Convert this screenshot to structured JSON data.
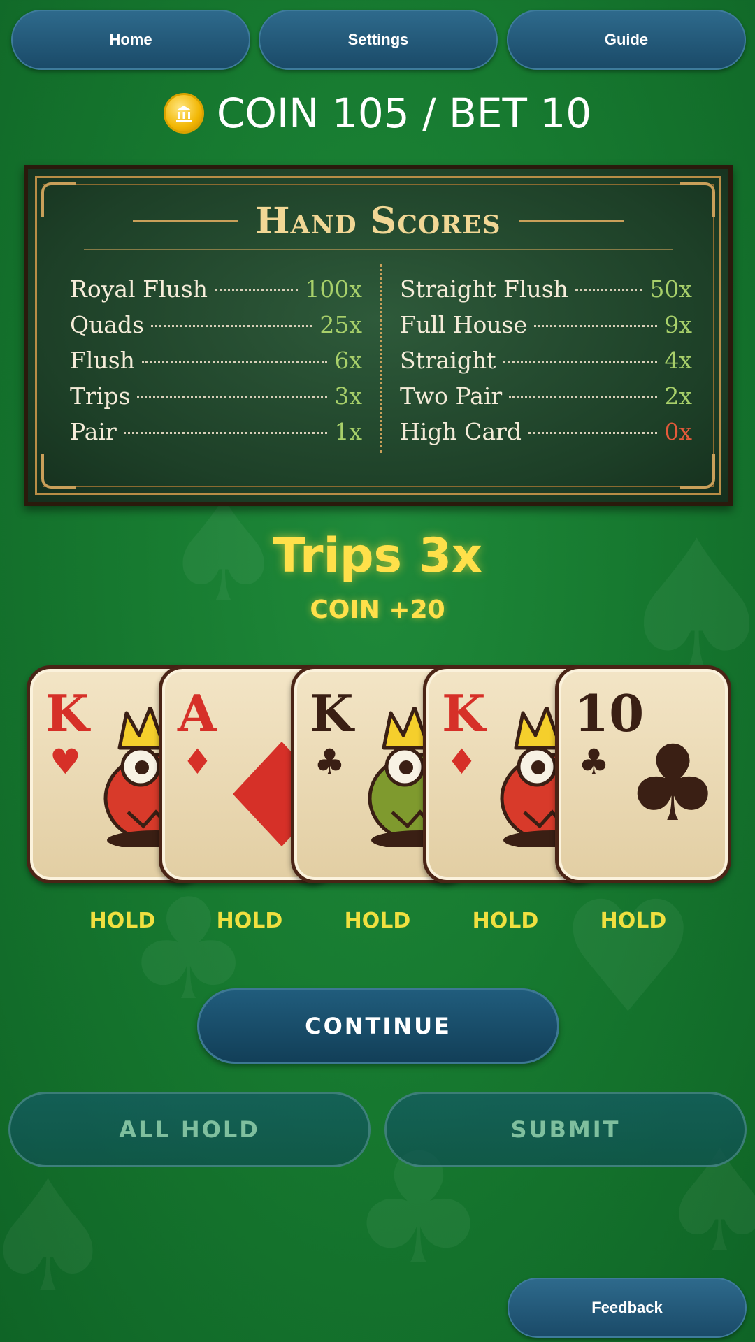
{
  "nav": {
    "home_label": "Home",
    "settings_label": "Settings",
    "guide_label": "Guide"
  },
  "status": {
    "coin_icon": "coin-icon",
    "text": "COIN 105 / BET 10"
  },
  "paytable": {
    "title": "Hand Scores",
    "left": [
      {
        "name": "Royal Flush",
        "value": "100x"
      },
      {
        "name": "Quads",
        "value": "25x"
      },
      {
        "name": "Flush",
        "value": "6x"
      },
      {
        "name": "Trips",
        "value": "3x"
      },
      {
        "name": "Pair",
        "value": "1x"
      }
    ],
    "right": [
      {
        "name": "Straight Flush",
        "value": "50x"
      },
      {
        "name": "Full House",
        "value": "9x"
      },
      {
        "name": "Straight",
        "value": "4x"
      },
      {
        "name": "Two Pair",
        "value": "2x"
      },
      {
        "name": "High Card",
        "value": "0x"
      }
    ]
  },
  "result": {
    "title": "Trips 3x",
    "coin": "COIN +20"
  },
  "cards": [
    {
      "rank": "K",
      "suit": "♥",
      "color": "#d63028"
    },
    {
      "rank": "A",
      "suit": "♦",
      "color": "#d63028"
    },
    {
      "rank": "K",
      "suit": "♣",
      "color": "#3a1f14"
    },
    {
      "rank": "K",
      "suit": "♦",
      "color": "#d63028"
    },
    {
      "rank": "10",
      "suit": "♣",
      "color": "#3a1f14"
    }
  ],
  "hold_labels": [
    "HOLD",
    "HOLD",
    "HOLD",
    "HOLD",
    "HOLD"
  ],
  "actions": {
    "continue_label": "CONTINUE",
    "all_hold_label": "ALL HOLD",
    "submit_label": "SUBMIT",
    "feedback_label": "Feedback"
  }
}
